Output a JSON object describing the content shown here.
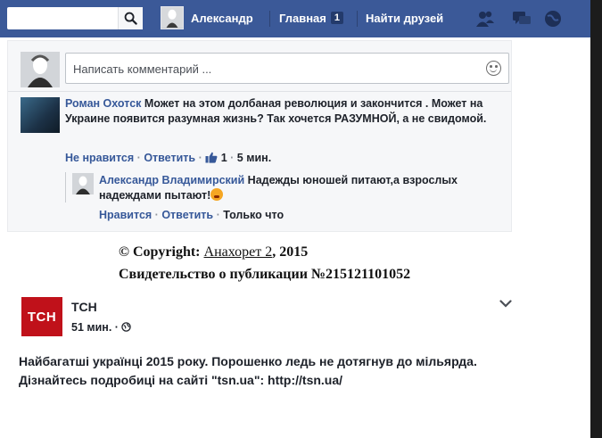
{
  "topbar": {
    "user_name": "Александр",
    "home_label": "Главная",
    "home_badge": "1",
    "friends_label": "Найти друзей"
  },
  "composer": {
    "placeholder": "Написать комментарий ..."
  },
  "comment1": {
    "author": "Роман Охотск",
    "text": " Может на этом долбаная революция и закончится . Может на Украине появится разумная жизнь? Так хочется РАЗУМНОЙ, а не свидомой.",
    "dislike": "Не нравится",
    "reply": "Ответить",
    "likes": "1",
    "time": "5 мин."
  },
  "comment2": {
    "author": "Александр Владимирский",
    "text": " Надежды юношей питают,а взрослых надеждами пытают!",
    "like": "Нравится",
    "reply": "Ответить",
    "time": "Только что"
  },
  "copyright": {
    "prefix": "© Copyright: ",
    "author_link": "Анахорет 2",
    "year": ", 2015",
    "certificate": "Свидетельство о публикации №215121101052"
  },
  "post": {
    "logo_text": "ТСН",
    "page_name": "ТСН",
    "time": "51 мин. ·",
    "text": "Найбагатші українці 2015 року. Порошенко ледь не дотягнув до мільярда. Дізнайтесь подробиці на сайті \"tsn.ua\": http://tsn.ua/"
  },
  "colors": {
    "topbar": "#3b5998",
    "link": "#365899",
    "tsn_red": "#c0111a"
  }
}
